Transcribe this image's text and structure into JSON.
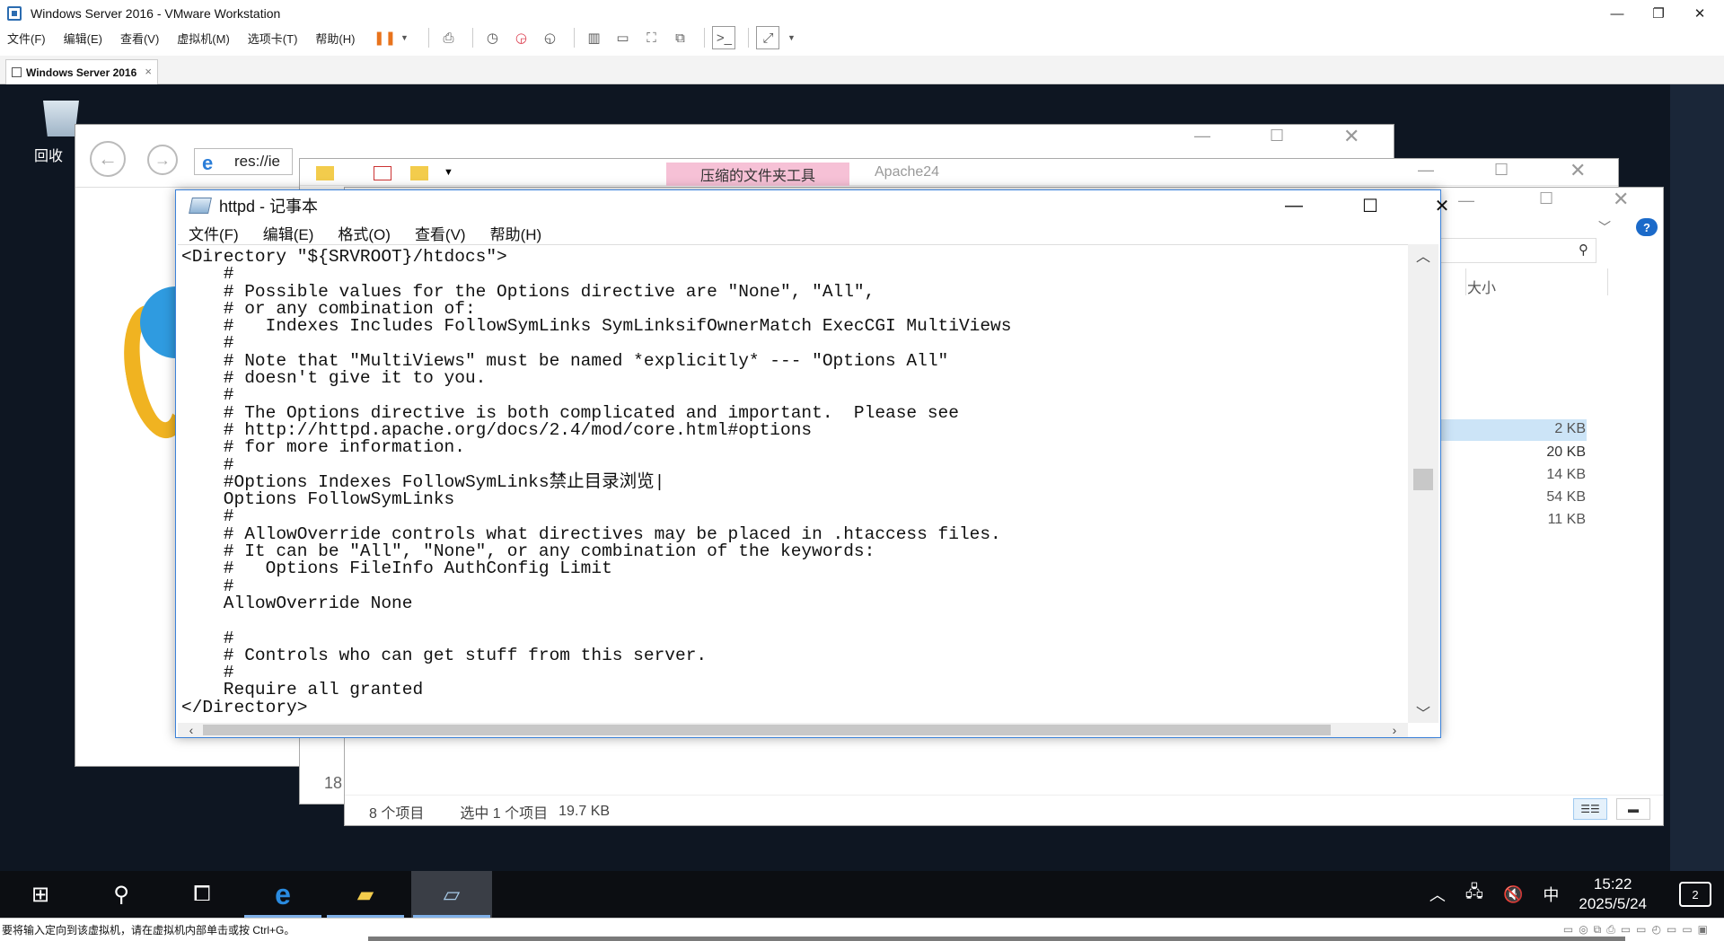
{
  "vmware": {
    "title": "Windows Server 2016 - VMware Workstation",
    "menu": [
      "文件(F)",
      "编辑(E)",
      "查看(V)",
      "虚拟机(M)",
      "选项卡(T)",
      "帮助(H)"
    ],
    "tab_label": "Windows Server 2016",
    "tab_close": "×",
    "status_hint": "要将输入定向到该虚拟机，请在虚拟机内部单击或按 Ctrl+G。"
  },
  "desktop": {
    "recycle_label": "回收"
  },
  "ie": {
    "address": "res://ie"
  },
  "explorer": {
    "zip_context_tab": "压缩的文件夹工具",
    "path_title": "Apache24",
    "column_size": "大小",
    "sizes": [
      "2 KB",
      "20 KB",
      "14 KB",
      "54 KB",
      "11 KB"
    ],
    "selected_index": 1,
    "status_items": "8 个项目",
    "status_selected": "选中 1 个项目",
    "status_size": "19.7 KB",
    "fragment": "18"
  },
  "notepad": {
    "title": "httpd - 记事本",
    "menu": [
      "文件(F)",
      "编辑(E)",
      "格式(O)",
      "查看(V)",
      "帮助(H)"
    ],
    "content": "<Directory \"${SRVROOT}/htdocs\">\n    #\n    # Possible values for the Options directive are \"None\", \"All\",\n    # or any combination of:\n    #   Indexes Includes FollowSymLinks SymLinksifOwnerMatch ExecCGI MultiViews\n    #\n    # Note that \"MultiViews\" must be named *explicitly* --- \"Options All\"\n    # doesn't give it to you.\n    #\n    # The Options directive is both complicated and important.  Please see\n    # http://httpd.apache.org/docs/2.4/mod/core.html#options\n    # for more information.\n    #\n    #Options Indexes FollowSymLinks禁止目录浏览|\n    Options FollowSymLinks\n    #\n    # AllowOverride controls what directives may be placed in .htaccess files.\n    # It can be \"All\", \"None\", or any combination of the keywords:\n    #   Options FileInfo AuthConfig Limit\n    #\n    AllowOverride None\n\n    #\n    # Controls who can get stuff from this server.\n    #\n    Require all granted\n</Directory>"
  },
  "taskbar": {
    "time": "15:22",
    "date": "2025/5/24",
    "ime": "中",
    "notifications": "2"
  }
}
